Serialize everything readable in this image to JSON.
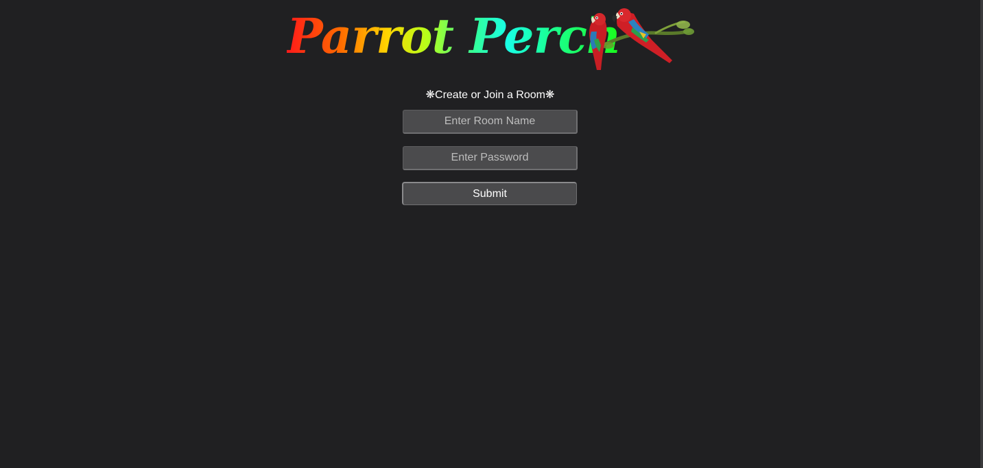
{
  "header": {
    "logo_text": "Parrot Perch",
    "logo_image": "parrots-on-branch-image"
  },
  "form": {
    "title": "❋Create or Join a Room❋",
    "room_name_placeholder": "Enter Room Name",
    "room_name_value": "",
    "password_placeholder": "Enter Password",
    "password_value": "",
    "submit_label": "Submit"
  },
  "colors": {
    "background": "#202022",
    "field_background": "#4b4b4d",
    "text": "#ffffff",
    "placeholder": "#bdbdbd"
  }
}
